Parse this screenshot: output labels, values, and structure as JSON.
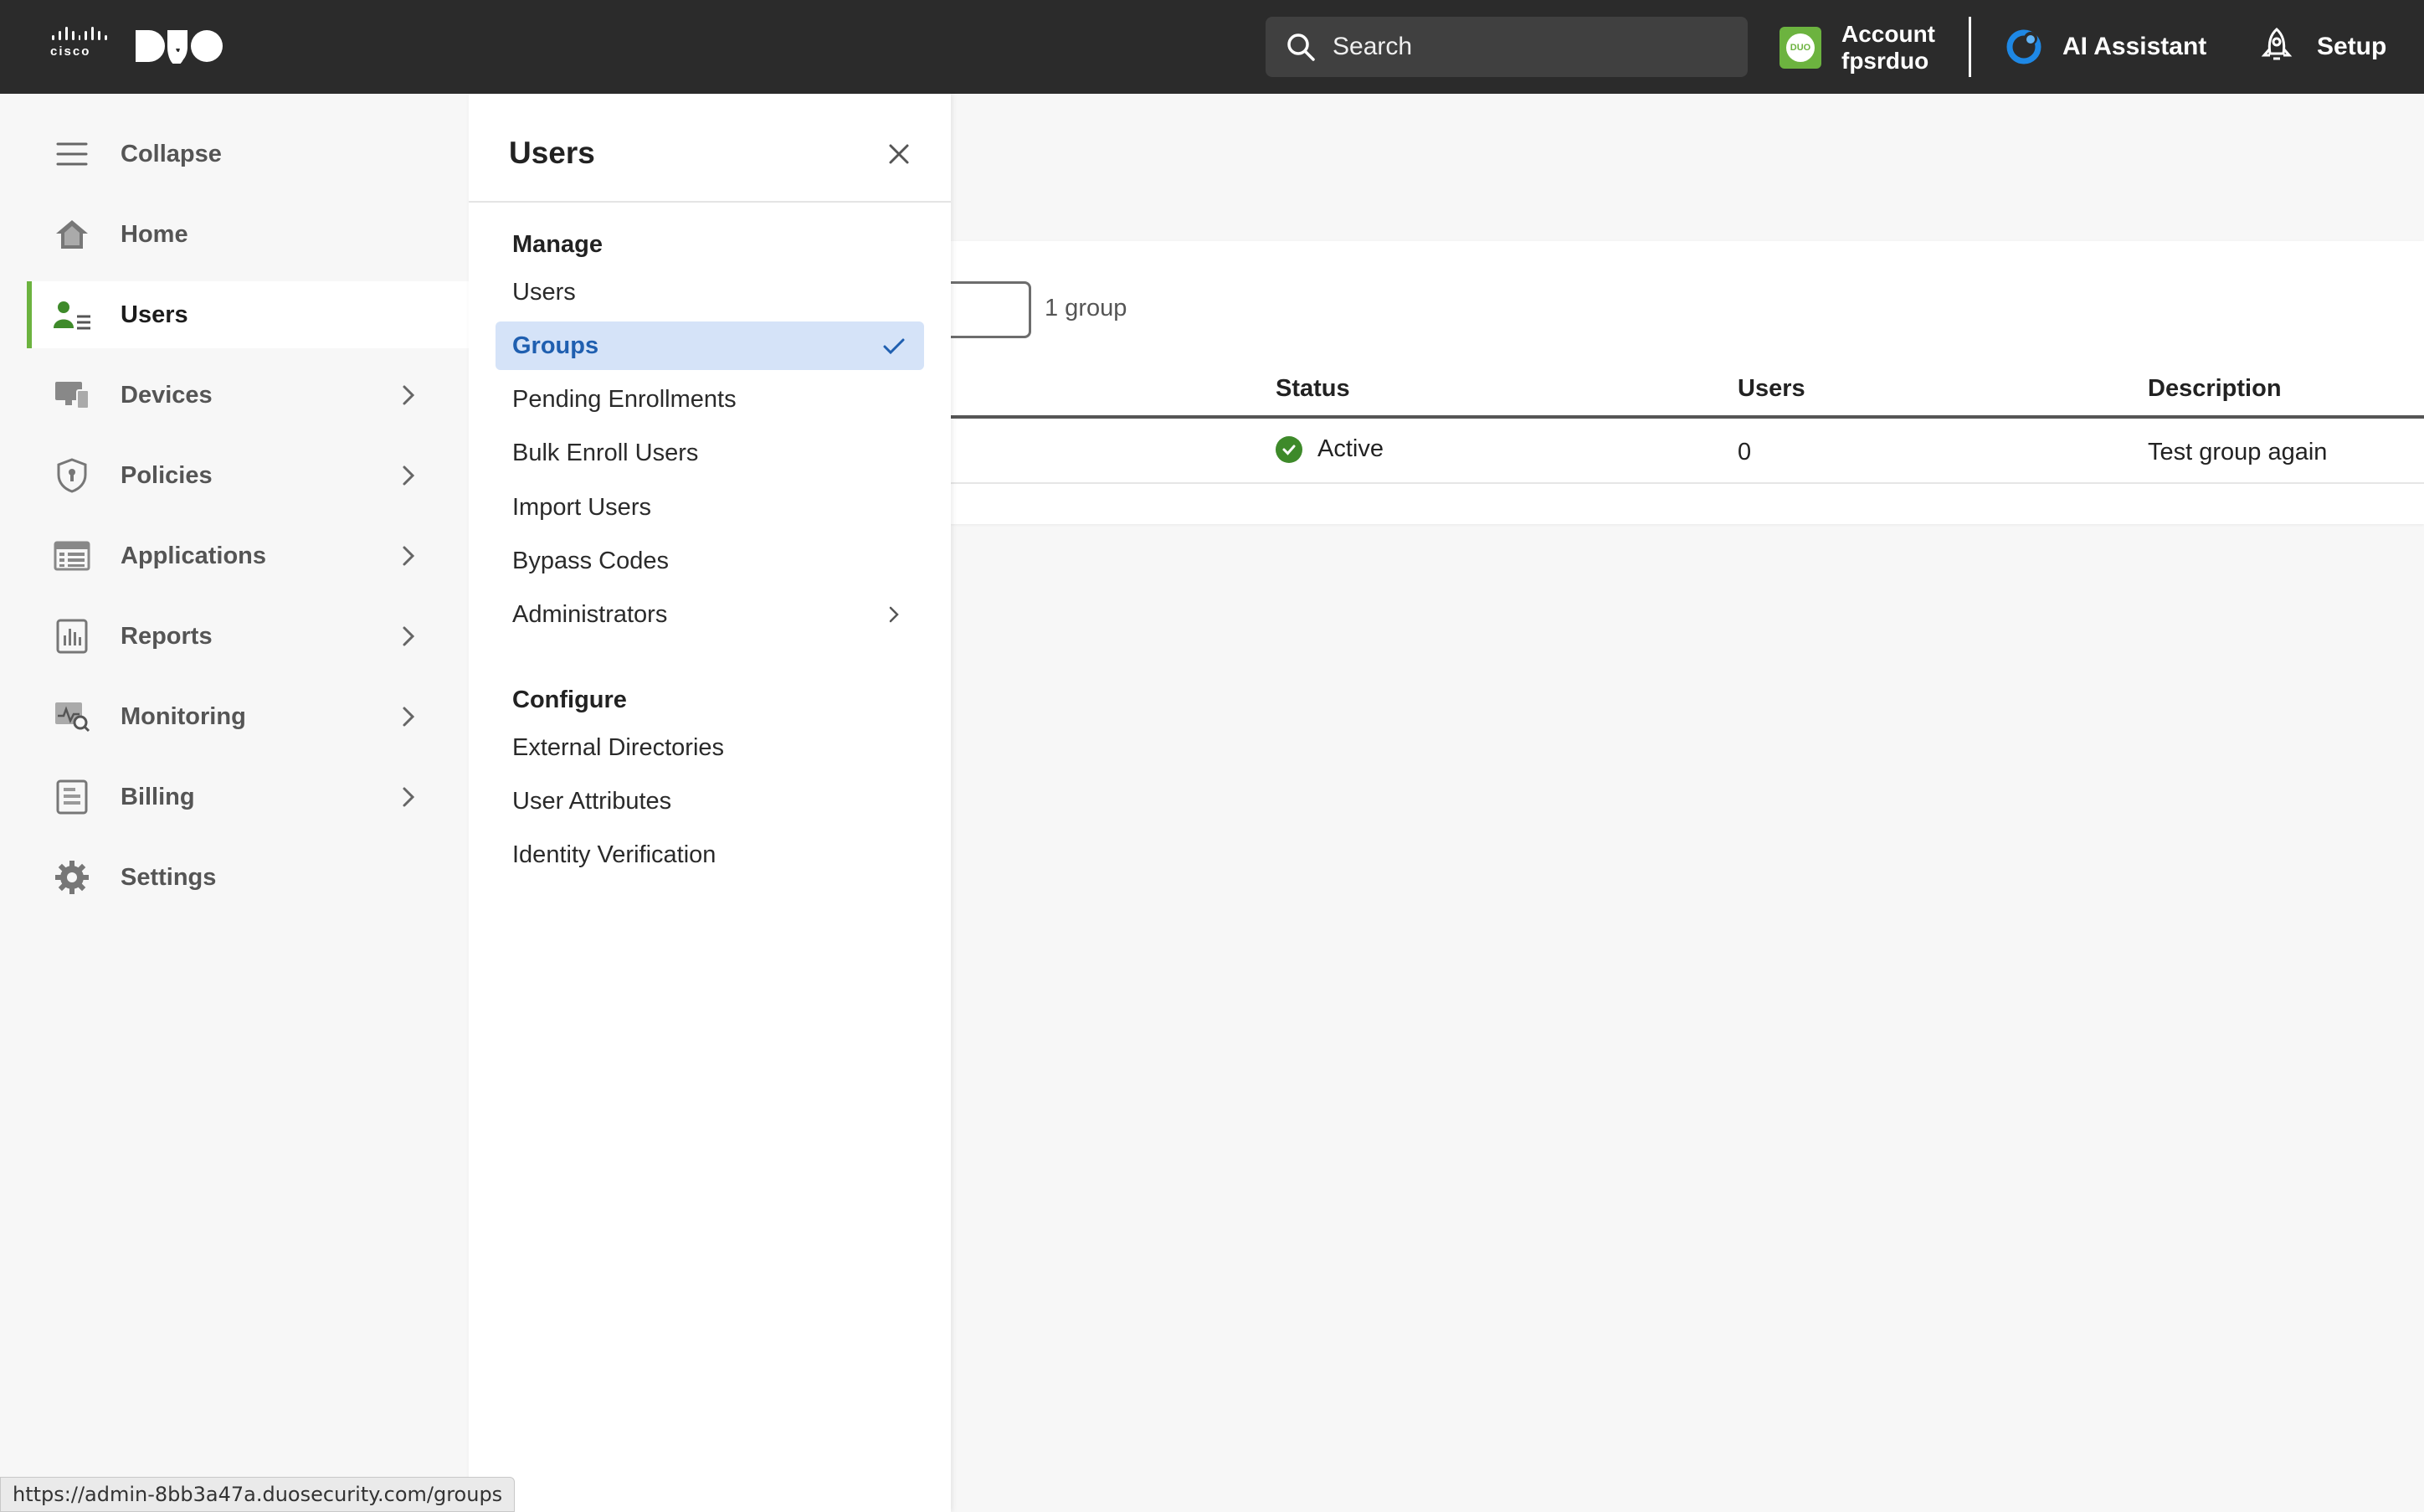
{
  "topbar": {
    "cisco_text": "cisco",
    "search_placeholder": "Search",
    "account_label": "Account",
    "account_name": "fpsrduo",
    "ai_assistant": "AI Assistant",
    "setup": "Setup"
  },
  "sidebar": {
    "items": [
      {
        "label": "Collapse",
        "icon": "hamburger-icon"
      },
      {
        "label": "Home",
        "icon": "home-icon"
      },
      {
        "label": "Users",
        "icon": "users-icon",
        "active": true
      },
      {
        "label": "Devices",
        "icon": "devices-icon",
        "chevron": true
      },
      {
        "label": "Policies",
        "icon": "shield-icon",
        "chevron": true
      },
      {
        "label": "Applications",
        "icon": "applications-icon",
        "chevron": true
      },
      {
        "label": "Reports",
        "icon": "reports-icon",
        "chevron": true
      },
      {
        "label": "Monitoring",
        "icon": "monitoring-icon",
        "chevron": true
      },
      {
        "label": "Billing",
        "icon": "billing-icon",
        "chevron": true
      },
      {
        "label": "Settings",
        "icon": "gear-icon"
      }
    ]
  },
  "flyout": {
    "title": "Users",
    "manage_heading": "Manage",
    "manage_links": [
      "Users",
      "Groups",
      "Pending Enrollments",
      "Bulk Enroll Users",
      "Import Users",
      "Bypass Codes",
      "Administrators"
    ],
    "selected": "Groups",
    "configure_heading": "Configure",
    "configure_links": [
      "External Directories",
      "User Attributes",
      "Identity Verification"
    ]
  },
  "main": {
    "group_count": "1 group",
    "columns": [
      "Status",
      "Users",
      "Description"
    ],
    "rows": [
      {
        "status": "Active",
        "users": "0",
        "description": "Test group again"
      }
    ]
  },
  "status_url": "https://admin-8bb3a47a.duosecurity.com/groups",
  "colors": {
    "accent_green": "#6cb33f",
    "selected_bg": "#d5e3f8",
    "selected_text": "#1f5fb0",
    "topbar_bg": "#2b2b2b"
  }
}
